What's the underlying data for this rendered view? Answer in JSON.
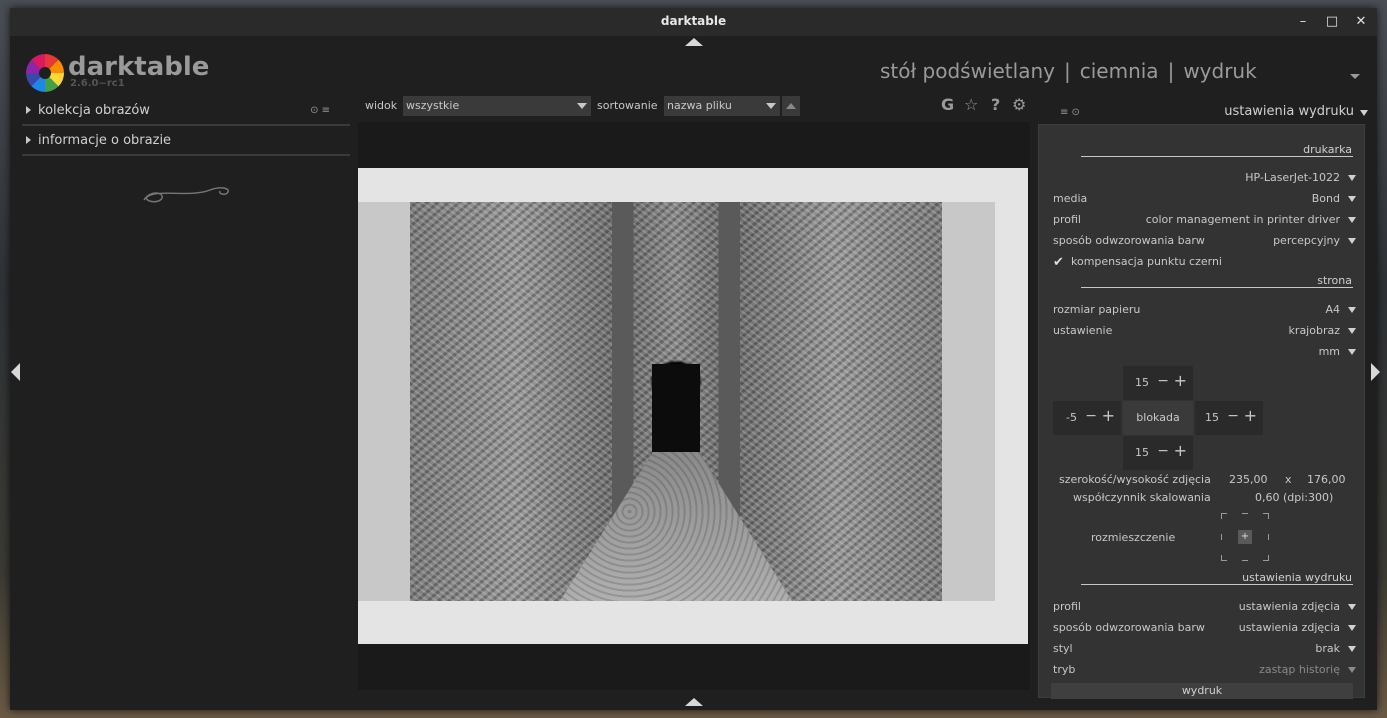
{
  "window": {
    "title": "darktable",
    "controls": {
      "minimize": "–",
      "maximize": "□",
      "close": "✕"
    }
  },
  "brand": {
    "name": "darktable",
    "version": "2.6.0~rc1"
  },
  "views": {
    "lighttable": "stół podświetlany",
    "darkroom": "ciemnia",
    "print": "wydruk",
    "separator": "|"
  },
  "left_panel": {
    "items": [
      {
        "label": "kolekcja obrazów",
        "icons": "⊙  ≡"
      },
      {
        "label": "informacje o obrazie"
      }
    ]
  },
  "toolbar": {
    "view_label": "widok",
    "view_value": "wszystkie",
    "sort_label": "sortowanie",
    "sort_value": "nazwa pliku",
    "icons": {
      "grouping": "G",
      "star": "☆",
      "help": "?",
      "settings": "⚙"
    }
  },
  "right_panel": {
    "header_icons": "≡  ⊙",
    "title": "ustawienia wydruku",
    "sections": {
      "printer": "drukarka",
      "page": "strona",
      "print_settings": "ustawienia wydruku"
    },
    "printer": {
      "name": "HP-LaserJet-1022",
      "media_label": "media",
      "media_value": "Bond",
      "profile_label": "profil",
      "profile_value": "color management in printer driver",
      "intent_label": "sposób odwzorowania barw",
      "intent_value": "percepcyjny",
      "bpc_label": "kompensacja punktu czerni"
    },
    "page": {
      "paper_label": "rozmiar papieru",
      "paper_value": "A4",
      "orientation_label": "ustawienie",
      "orientation_value": "krajobraz",
      "unit_value": "mm",
      "margin_top": "15",
      "margin_left": "-5",
      "margin_right": "15",
      "margin_bottom": "15",
      "lock_label": "blokada",
      "size_label": "szerokość/wysokość zdjęcia",
      "width": "235,00",
      "x": "x",
      "height": "176,00",
      "scale_label": "współczynnik skalowania",
      "scale_value": "0,60 (dpi:300)",
      "alignment_label": "rozmieszczenie",
      "minus": "−",
      "plus": "+"
    },
    "print_settings": {
      "profile_label": "profil",
      "profile_value": "ustawienia zdjęcia",
      "intent_label": "sposób odwzorowania barw",
      "intent_value": "ustawienia zdjęcia",
      "style_label": "styl",
      "style_value": "brak",
      "mode_label": "tryb",
      "mode_value": "zastąp historię"
    },
    "print_button": "wydruk"
  },
  "colors": {
    "panel_bg": "#333333",
    "window_bg": "#1f1f1f",
    "paper": "#e4e4e4",
    "text": "#c8c8c8"
  }
}
